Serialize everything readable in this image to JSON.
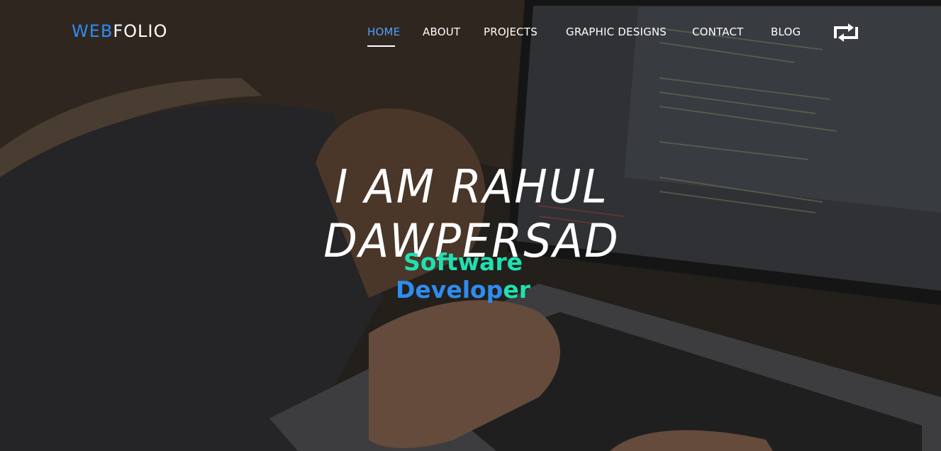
{
  "brand": {
    "part1": "WEB",
    "part2": "FOLIO"
  },
  "nav": {
    "items": [
      {
        "label": "HOME",
        "active": true
      },
      {
        "label": "ABOUT",
        "active": false
      },
      {
        "label": "PROJECTS",
        "active": false
      },
      {
        "label": "GRAPHIC DESIGNS",
        "active": false
      },
      {
        "label": "CONTACT",
        "active": false
      },
      {
        "label": "BLOG",
        "active": false
      }
    ],
    "toggle_icon": "repeat-icon"
  },
  "hero": {
    "title": "I AM RAHUL DAWPERSAD",
    "subtitle_part1": "Software",
    "subtitle_part2": "Develop",
    "subtitle_part3": "er"
  },
  "colors": {
    "accent_blue": "#2d8cf0",
    "accent_teal": "#1fe0b0",
    "active_nav": "#4fa0ff"
  }
}
